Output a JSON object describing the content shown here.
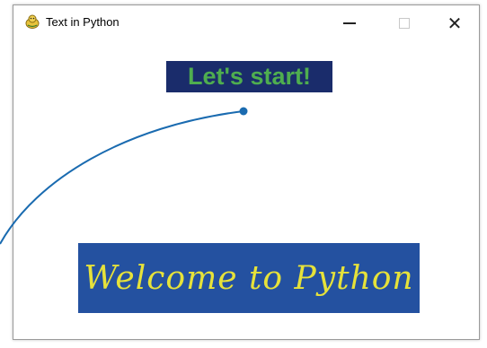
{
  "window": {
    "title": "Text in Python",
    "controls": {
      "minimize": "minimize",
      "maximize": "maximize",
      "close": "close"
    }
  },
  "content": {
    "top_banner": {
      "text": "Let's start!",
      "text_color": "#4fae4f",
      "background": "#1a2c6b"
    },
    "bottom_banner": {
      "text": "Welcome to Python",
      "text_color": "#e6e23a",
      "background": "#2451a0"
    }
  },
  "annotation": {
    "color": "#1a6bb0"
  }
}
